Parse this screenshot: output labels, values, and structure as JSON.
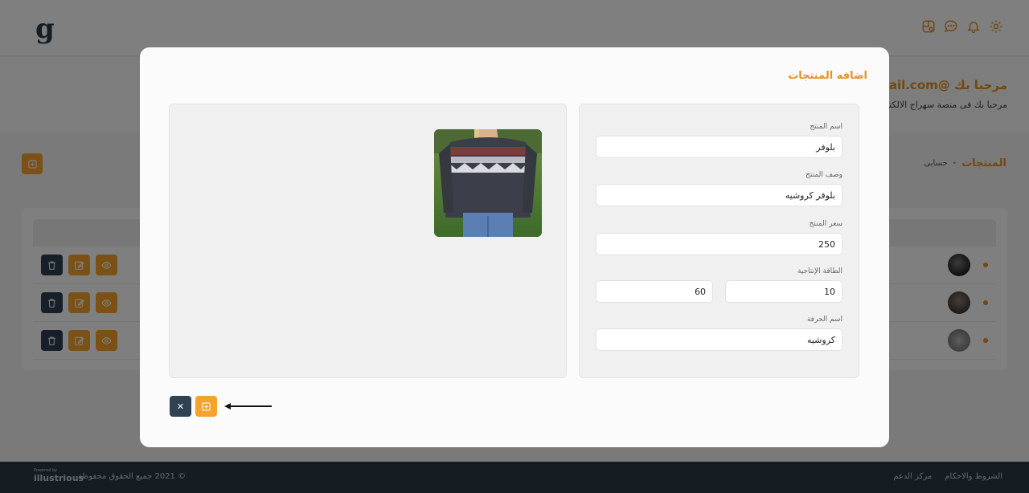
{
  "header": {
    "logo": "g",
    "icons": [
      "settings-icon",
      "bell-icon",
      "chat-icon",
      "dashboard-icon"
    ],
    "accent_color": "#e8911f"
  },
  "welcome": {
    "title": "مرحبا بك @gmail.com",
    "subtitle": "مرحبا بك فى منصة سهراج الالكتر"
  },
  "breadcrumb": {
    "home": "حسابى",
    "separator": "•",
    "current": "المنتجات"
  },
  "background_table": {
    "rows": [
      {
        "avatar": "product-thumb-1"
      },
      {
        "avatar": "product-thumb-2"
      },
      {
        "avatar": "product-thumb-3"
      }
    ]
  },
  "modal": {
    "title": "اضافه المنتجات",
    "fields": {
      "product_name": {
        "label": "اسم المنتج",
        "value": "بلوفر"
      },
      "product_description": {
        "label": "وصف المنتج",
        "value": "بلوفر كروشيه"
      },
      "product_price": {
        "label": "سعر المنتج",
        "value": "250"
      },
      "capacity": {
        "label": "الطاقة الإنتاجية",
        "value_a": "10",
        "value_b": "60"
      },
      "craft_name": {
        "label": "اسم الحرفة",
        "value": "كروشيه"
      }
    },
    "image": {
      "alt": "product image"
    },
    "buttons": {
      "close": "✕",
      "add_icon": "plus-square-icon"
    }
  },
  "footer": {
    "links": [
      "مركز الدعم",
      "الشروط والاحكام"
    ],
    "copyright": "© 2021 جميع الحقوق محفوظة",
    "powered_by": "Powered by",
    "brand": "illustrious"
  }
}
